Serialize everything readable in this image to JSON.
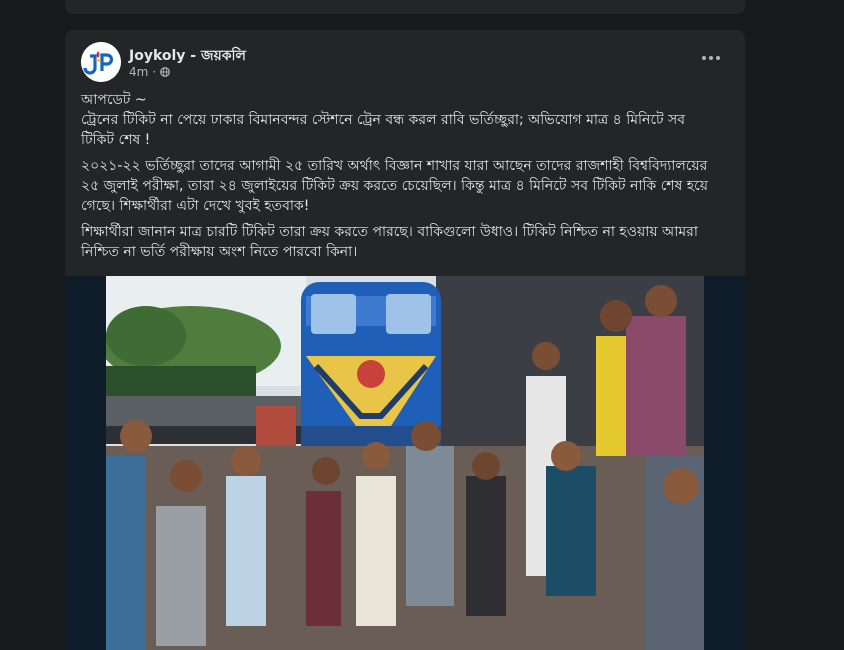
{
  "post": {
    "author": "Joykoly - জয়কলি",
    "time": "4m",
    "separator": "·",
    "update_label": "আপডেট ~",
    "headline": "ট্রেনের টিকিট না পেয়ে ঢাকার বিমানবন্দর স্টেশনে ট্রেন বন্ধ করল রাবি ভর্তিচ্ছুরা; অভিযোগ মাত্র ৪ মিনিটে সব টিকিট শেষ !",
    "paragraph_1": "২০২১-২২ ভর্তিচ্ছুরা তাদের আগামী ২৫ তারিখ অর্থাৎ বিজ্ঞান শাখার যারা আছেন তাদের রাজশাহী বিশ্ববিদ্যালয়ের ২৫ জুলাই পরীক্ষা, তারা ২৪ জুলাইয়ের টিকিট ক্রয় করতে চেয়েছিল। কিন্তু মাত্র ৪ মিনিটে সব টিকিট নাকি শেষ হয়ে গেছে। শিক্ষার্থীরা এটা দেখে খুবই হতবাক!",
    "paragraph_2": "শিক্ষার্থীরা জানান মাত্র চারটি টিকিট তারা ক্রয় করতে পারছে। বাকিগুলো উধাও। টিকিট নিশ্চিত না হওয়ায় আমরা নিশ্চিত না ভর্তি পরীক্ষায় অংশ নিতে পারবো কিনা।"
  },
  "icons": {
    "globe": "globe-icon",
    "more": "more-options-icon",
    "avatar_logo": "joykoly-logo"
  },
  "colors": {
    "page_bg": "#18191a",
    "card_bg": "#242526",
    "text_primary": "#e4e6eb",
    "text_secondary": "#b0b3b8",
    "train_blue": "#1f5fb8",
    "train_yellow": "#e8c547",
    "logo_blue": "#1565c0",
    "logo_red": "#d32f2f"
  }
}
